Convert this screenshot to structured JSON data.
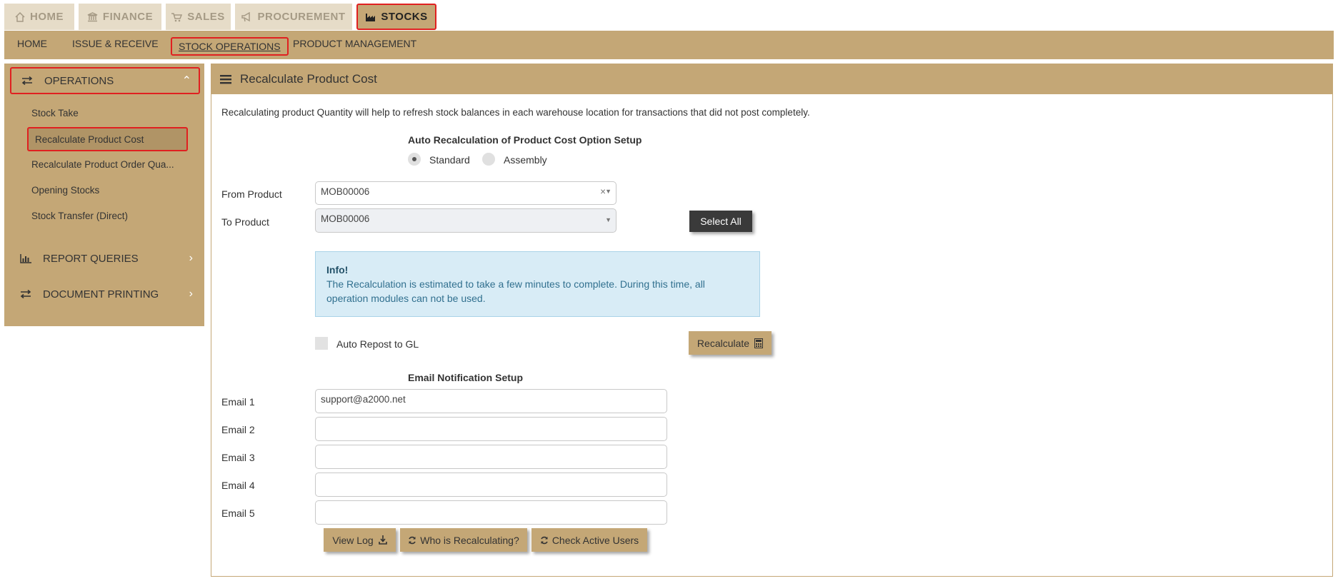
{
  "top_tabs": [
    {
      "label": "HOME",
      "icon": "home-icon"
    },
    {
      "label": "FINANCE",
      "icon": "bank-icon"
    },
    {
      "label": "SALES",
      "icon": "cart-icon"
    },
    {
      "label": "PROCUREMENT",
      "icon": "megaphone-icon"
    },
    {
      "label": "STOCKS",
      "icon": "factory-icon",
      "active": true
    }
  ],
  "sub_nav": [
    "HOME",
    "ISSUE & RECEIVE",
    "STOCK OPERATIONS",
    "PRODUCT MANAGEMENT"
  ],
  "sidebar": {
    "operations": {
      "label": "OPERATIONS",
      "icon": "exchange-icon"
    },
    "items": [
      "Stock Take",
      "Recalculate Product Cost",
      "Recalculate Product Order Qua...",
      "Opening Stocks",
      "Stock Transfer (Direct)"
    ],
    "report_queries": {
      "label": "REPORT QUERIES",
      "icon": "bar-chart-icon"
    },
    "document_printing": {
      "label": "DOCUMENT PRINTING",
      "icon": "exchange-icon"
    }
  },
  "panel": {
    "title": "Recalculate Product Cost",
    "description": "Recalculating product Quantity will help to refresh stock balances in each warehouse location for transactions that did not post completely.",
    "option_title": "Auto Recalculation of Product Cost Option Setup",
    "radio_standard": "Standard",
    "radio_assembly": "Assembly",
    "from_label": "From Product",
    "from_value": "MOB00006",
    "to_label": "To Product",
    "to_value": "MOB00006",
    "select_all": "Select All",
    "info_title": "Info!",
    "info_text": "The Recalculation is estimated to take a few minutes to complete. During this time, all operation modules can not be used.",
    "auto_repost": "Auto Repost to GL",
    "recalculate": "Recalculate",
    "email_title": "Email Notification Setup",
    "emails": [
      {
        "label": "Email 1",
        "value": "support@a2000.net"
      },
      {
        "label": "Email 2",
        "value": ""
      },
      {
        "label": "Email 3",
        "value": ""
      },
      {
        "label": "Email 4",
        "value": ""
      },
      {
        "label": "Email 5",
        "value": ""
      }
    ],
    "view_log": "View Log",
    "who_recalc": "Who is Recalculating?",
    "check_users": "Check Active Users"
  },
  "colors": {
    "brand": "#c4a776",
    "highlight": "#e02020",
    "info_bg": "#d8ecf6",
    "dark_button": "#3a3a3a"
  }
}
